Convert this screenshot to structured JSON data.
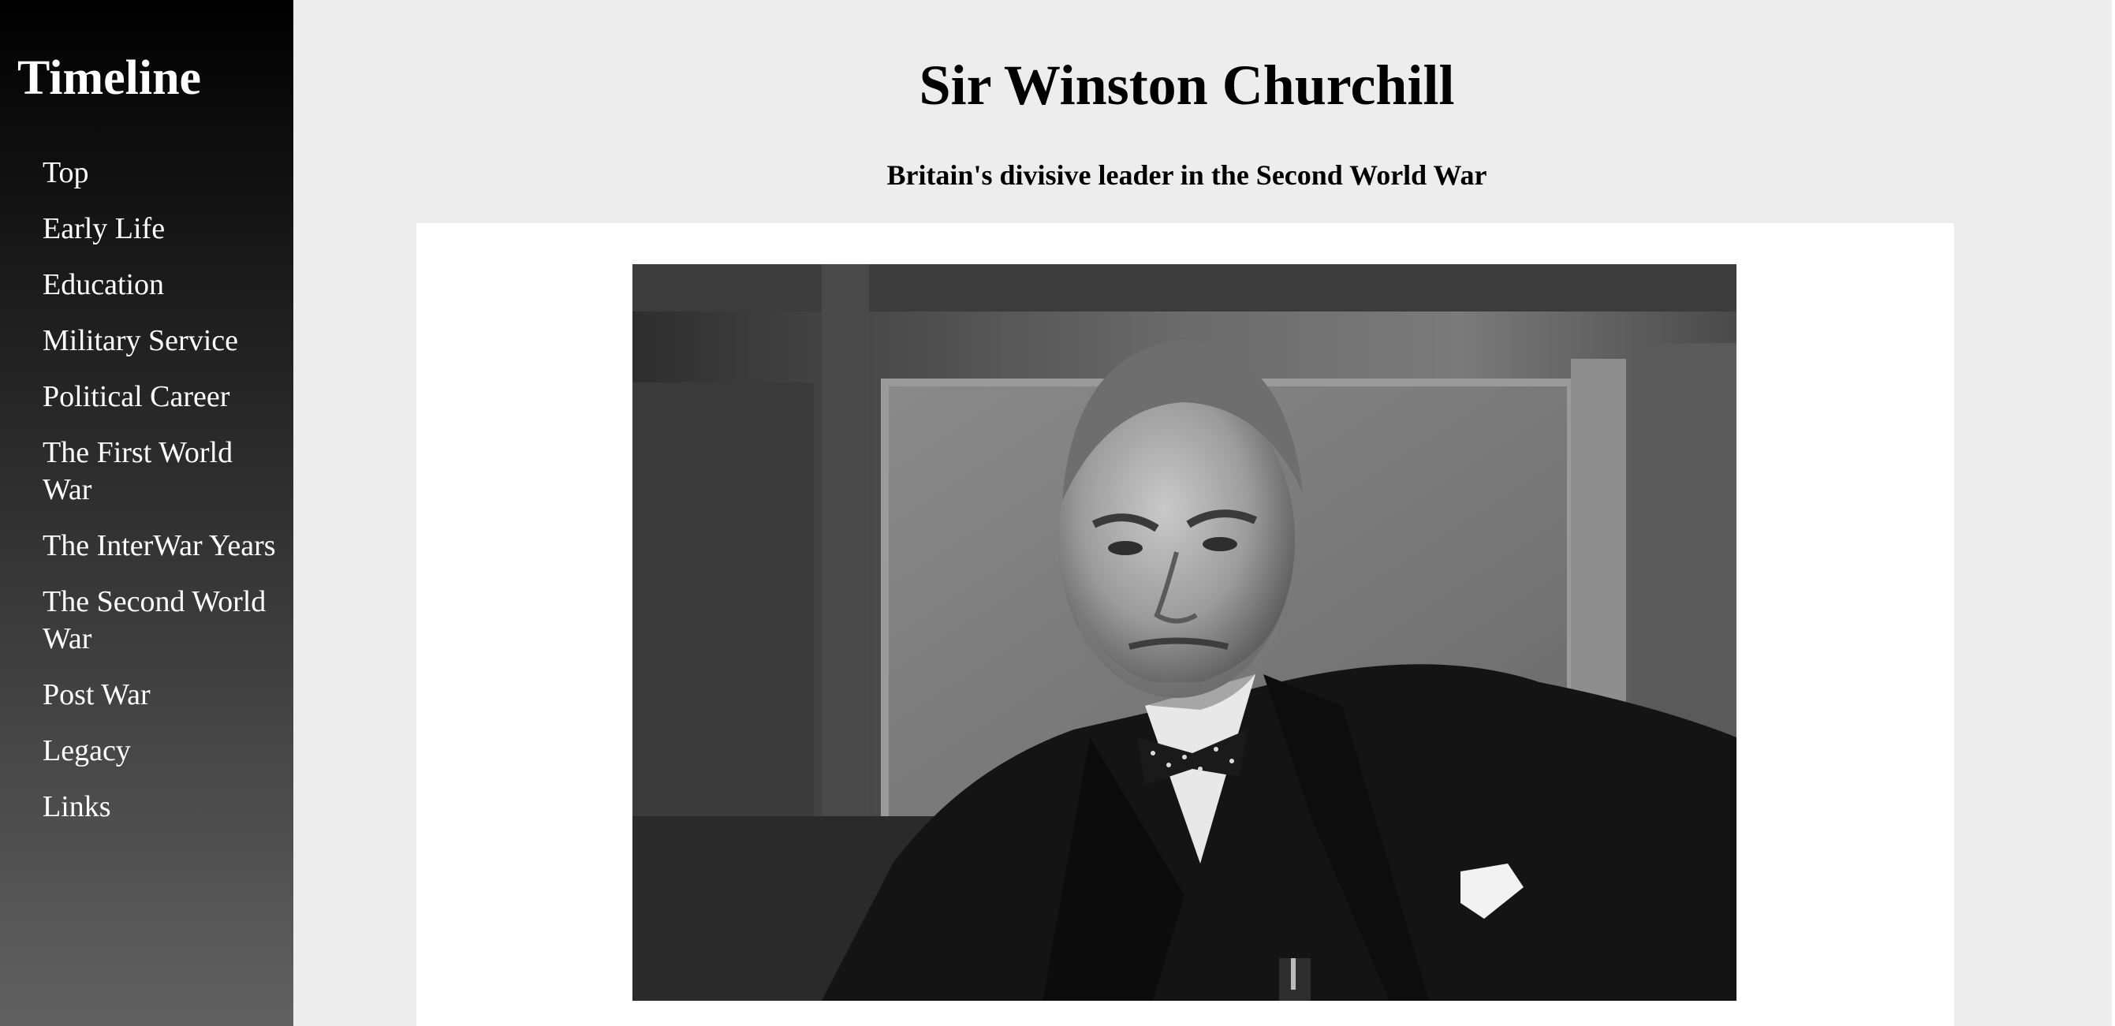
{
  "sidebar": {
    "title": "Timeline",
    "items": [
      {
        "label": "Top"
      },
      {
        "label": "Early Life"
      },
      {
        "label": "Education"
      },
      {
        "label": "Military Service"
      },
      {
        "label": "Political Career"
      },
      {
        "label": "The First World War"
      },
      {
        "label": "The InterWar Years"
      },
      {
        "label": "The Second World War"
      },
      {
        "label": "Post War"
      },
      {
        "label": "Legacy"
      },
      {
        "label": "Links"
      }
    ]
  },
  "header": {
    "title": "Sir Winston Churchill",
    "subtitle": "Britain's divisive leader in the Second World War"
  },
  "main": {
    "image": {
      "icon": "portrait-photo",
      "subject": "black-and-white portrait"
    }
  },
  "colors": {
    "sidebar_top": "#000000",
    "sidebar_bottom": "#616161",
    "page_background": "#ededed",
    "panel_background": "#ffffff"
  }
}
